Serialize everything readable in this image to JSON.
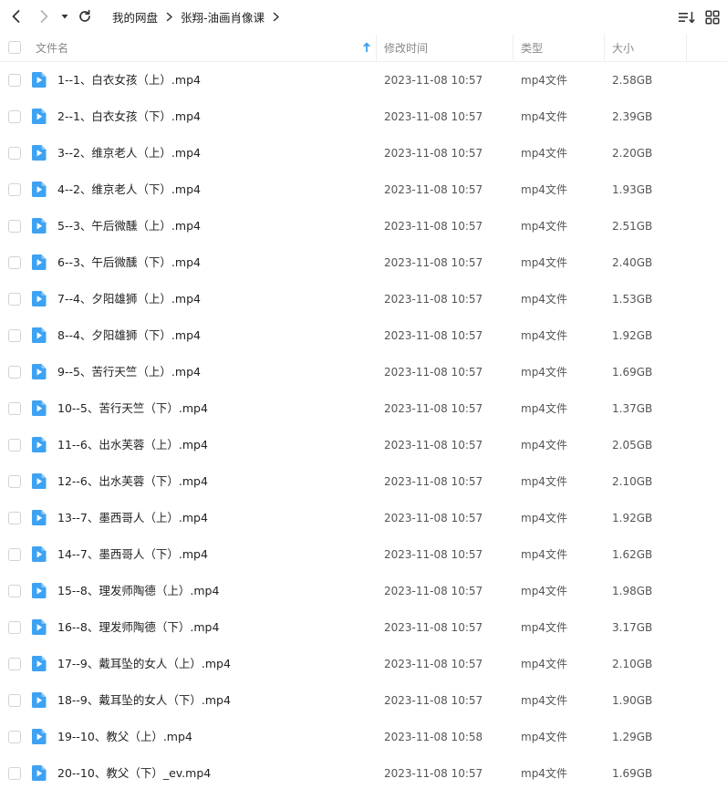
{
  "toolbar": {
    "back_icon": "chevron-left-icon",
    "forward_icon": "chevron-right-icon",
    "history_icon": "caret-down-icon",
    "refresh_icon": "refresh-icon",
    "breadcrumb": [
      "我的网盘",
      "张翔-油画肖像课"
    ],
    "sort_icon": "sort-list-icon",
    "view_icon": "grid-view-icon"
  },
  "columns": {
    "name": "文件名",
    "modified": "修改时间",
    "type": "类型",
    "size": "大小",
    "sort_indicator": "arrow-up-icon",
    "sort_color": "#3ea2f3"
  },
  "colors": {
    "file_icon": "#3ea2f3"
  },
  "files": [
    {
      "name": "1--1、白衣女孩（上）.mp4",
      "modified": "2023-11-08 10:57",
      "type": "mp4文件",
      "size": "2.58GB"
    },
    {
      "name": "2--1、白衣女孩（下）.mp4",
      "modified": "2023-11-08 10:57",
      "type": "mp4文件",
      "size": "2.39GB"
    },
    {
      "name": "3--2、维京老人（上）.mp4",
      "modified": "2023-11-08 10:57",
      "type": "mp4文件",
      "size": "2.20GB"
    },
    {
      "name": "4--2、维京老人（下）.mp4",
      "modified": "2023-11-08 10:57",
      "type": "mp4文件",
      "size": "1.93GB"
    },
    {
      "name": "5--3、午后微醺（上）.mp4",
      "modified": "2023-11-08 10:57",
      "type": "mp4文件",
      "size": "2.51GB"
    },
    {
      "name": "6--3、午后微醺（下）.mp4",
      "modified": "2023-11-08 10:57",
      "type": "mp4文件",
      "size": "2.40GB"
    },
    {
      "name": "7--4、夕阳雄狮（上）.mp4",
      "modified": "2023-11-08 10:57",
      "type": "mp4文件",
      "size": "1.53GB"
    },
    {
      "name": "8--4、夕阳雄狮（下）.mp4",
      "modified": "2023-11-08 10:57",
      "type": "mp4文件",
      "size": "1.92GB"
    },
    {
      "name": "9--5、苦行天竺（上）.mp4",
      "modified": "2023-11-08 10:57",
      "type": "mp4文件",
      "size": "1.69GB"
    },
    {
      "name": "10--5、苦行天竺（下）.mp4",
      "modified": "2023-11-08 10:57",
      "type": "mp4文件",
      "size": "1.37GB"
    },
    {
      "name": "11--6、出水芙蓉（上）.mp4",
      "modified": "2023-11-08 10:57",
      "type": "mp4文件",
      "size": "2.05GB"
    },
    {
      "name": "12--6、出水芙蓉（下）.mp4",
      "modified": "2023-11-08 10:57",
      "type": "mp4文件",
      "size": "2.10GB"
    },
    {
      "name": "13--7、墨西哥人（上）.mp4",
      "modified": "2023-11-08 10:57",
      "type": "mp4文件",
      "size": "1.92GB"
    },
    {
      "name": "14--7、墨西哥人（下）.mp4",
      "modified": "2023-11-08 10:57",
      "type": "mp4文件",
      "size": "1.62GB"
    },
    {
      "name": "15--8、理发师陶德（上）.mp4",
      "modified": "2023-11-08 10:57",
      "type": "mp4文件",
      "size": "1.98GB"
    },
    {
      "name": "16--8、理发师陶德（下）.mp4",
      "modified": "2023-11-08 10:57",
      "type": "mp4文件",
      "size": "3.17GB"
    },
    {
      "name": "17--9、戴耳坠的女人（上）.mp4",
      "modified": "2023-11-08 10:57",
      "type": "mp4文件",
      "size": "2.10GB"
    },
    {
      "name": "18--9、戴耳坠的女人（下）.mp4",
      "modified": "2023-11-08 10:57",
      "type": "mp4文件",
      "size": "1.90GB"
    },
    {
      "name": "19--10、教父（上）.mp4",
      "modified": "2023-11-08 10:58",
      "type": "mp4文件",
      "size": "1.29GB"
    },
    {
      "name": "20--10、教父（下）_ev.mp4",
      "modified": "2023-11-08 10:57",
      "type": "mp4文件",
      "size": "1.69GB"
    }
  ]
}
